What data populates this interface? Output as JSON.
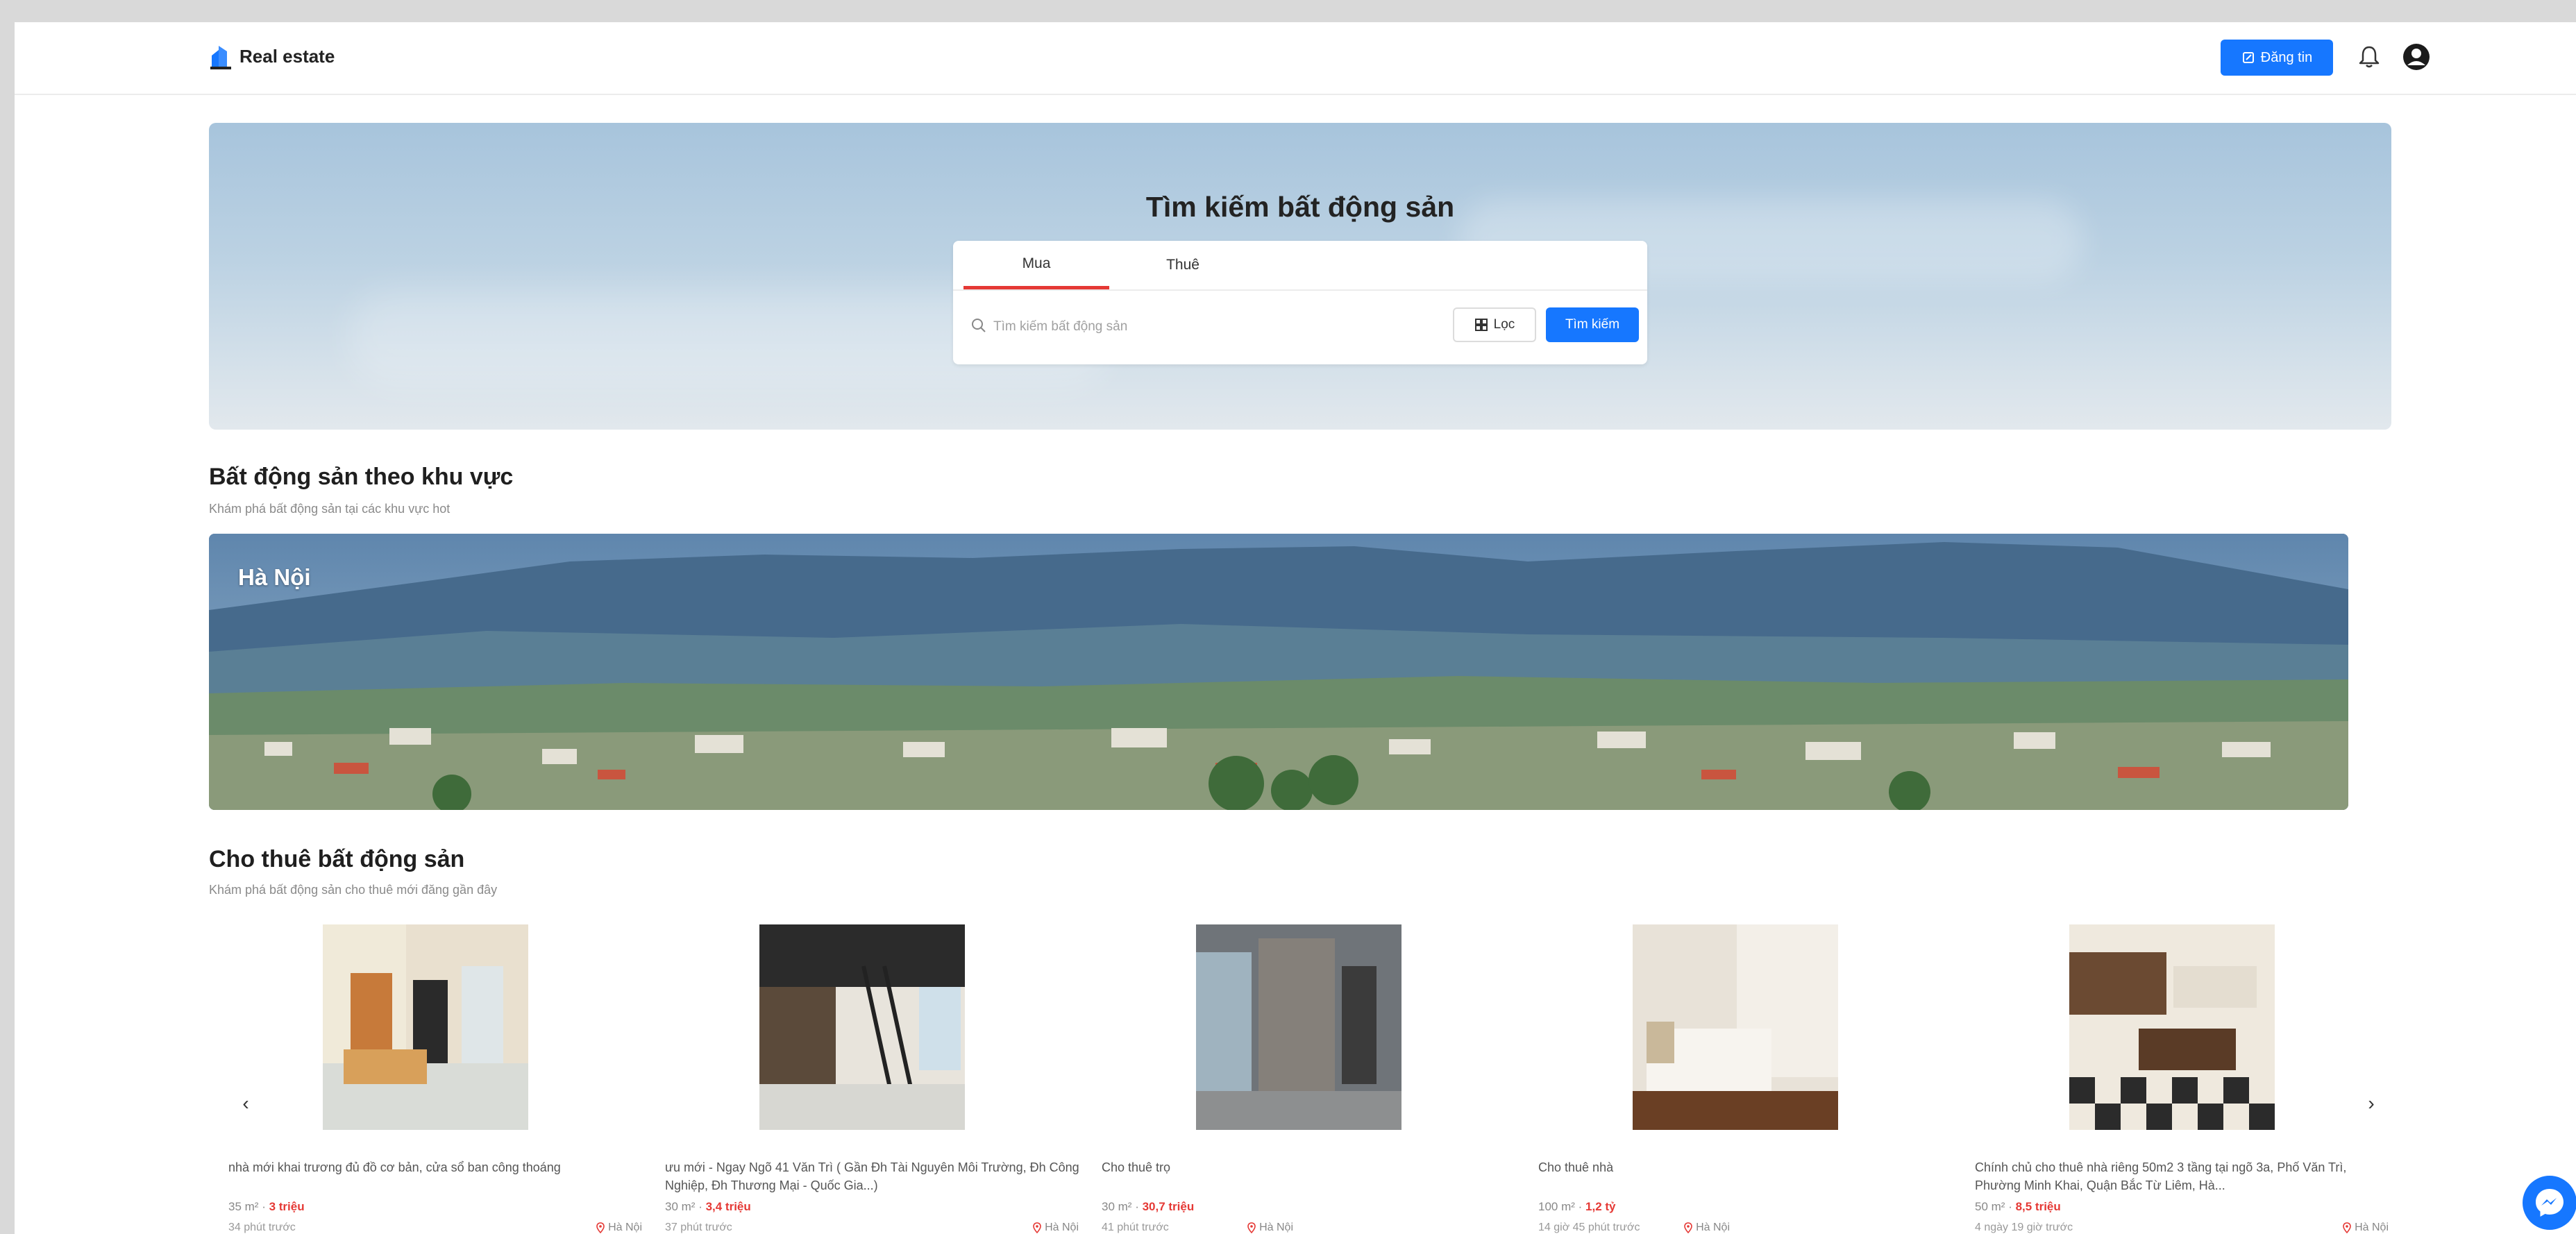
{
  "header": {
    "logo_text": "Real estate",
    "post_label": "Đăng tin"
  },
  "hero": {
    "title": "Tìm kiếm bất động sản",
    "tabs": [
      {
        "label": "Mua"
      },
      {
        "label": "Thuê"
      }
    ],
    "search_placeholder": "Tìm kiếm bất động sản",
    "filter_label": "Lọc",
    "search_label": "Tìm kiếm"
  },
  "region_section": {
    "title": "Bất động sản theo khu vực",
    "subtitle": "Khám phá bất động sản tại các khu vực hot",
    "region_name": "Hà Nội"
  },
  "rent_section": {
    "title": "Cho thuê bất động sản",
    "subtitle": "Khám phá bất động sản cho thuê mới đăng gần đây",
    "listings": [
      {
        "title": "nhà mới khai trương đủ đồ cơ bản, cửa sổ ban công thoáng",
        "area": "35 m²",
        "price": "3 triệu",
        "time": "34 phút trước",
        "location": "Hà Nội"
      },
      {
        "title": "ưu mới - Ngay Ngõ 41 Văn Trì ( Gần Đh Tài Nguyên Môi Trường, Đh Công Nghiệp, Đh Thương Mại - Quốc Gia...)",
        "area": "30 m²",
        "price": "3,4 triệu",
        "time": "37 phút trước",
        "location": "Hà Nội"
      },
      {
        "title": "Cho thuê trọ",
        "area": "30 m²",
        "price": "30,7 triệu",
        "time": "41 phút trước",
        "location": "Hà Nội"
      },
      {
        "title": "Cho thuê nhà",
        "area": "100 m²",
        "price": "1,2 tỷ",
        "time": "14 giờ 45 phút trước",
        "location": "Hà Nội"
      },
      {
        "title": "Chính chủ cho thuê nhà riêng 50m2 3 tầng tại ngõ 3a, Phố Văn Trì, Phường Minh Khai, Quận Bắc Từ Liêm, Hà...",
        "area": "50 m²",
        "price": "8,5 triệu",
        "time": "4 ngày 19 giờ trước",
        "location": "Hà Nội"
      }
    ]
  },
  "colors": {
    "primary": "#1677ff",
    "price": "#e53935",
    "tab_active": "#e53935"
  }
}
